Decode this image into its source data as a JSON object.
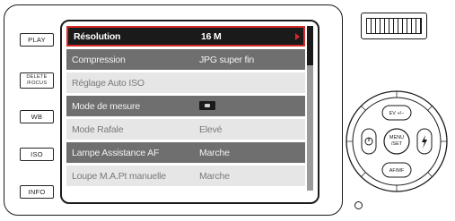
{
  "side_buttons": {
    "play": "PLAY",
    "delete_focus_line1": "DELETE",
    "delete_focus_line2": "/FOCUS",
    "wb": "WB",
    "iso": "ISO",
    "info": "INFO"
  },
  "menu": {
    "items": [
      {
        "label": "Résolution",
        "value": "16 M"
      },
      {
        "label": "Compression",
        "value": "JPG super fin"
      },
      {
        "label": "Réglage Auto ISO",
        "value": ""
      },
      {
        "label": "Mode de mesure",
        "value": "",
        "icon": "metering-mode-icon"
      },
      {
        "label": "Mode Rafale",
        "value": "Elevé"
      },
      {
        "label": "Lampe Assistance  AF",
        "value": "Marche"
      },
      {
        "label": "Loupe M.A.Pt manuelle",
        "value": "Marche"
      }
    ],
    "selected_index": 0
  },
  "dial": {
    "up": "EV +/−",
    "down": "AF/MF",
    "center_line1": "MENU",
    "center_line2": "/SET",
    "left_icon": "self-timer-icon",
    "right_icon": "flash-icon"
  },
  "colors": {
    "selection_border": "#d62828",
    "row_dark": "#6f6f6f",
    "row_light": "#e6e6e6"
  }
}
